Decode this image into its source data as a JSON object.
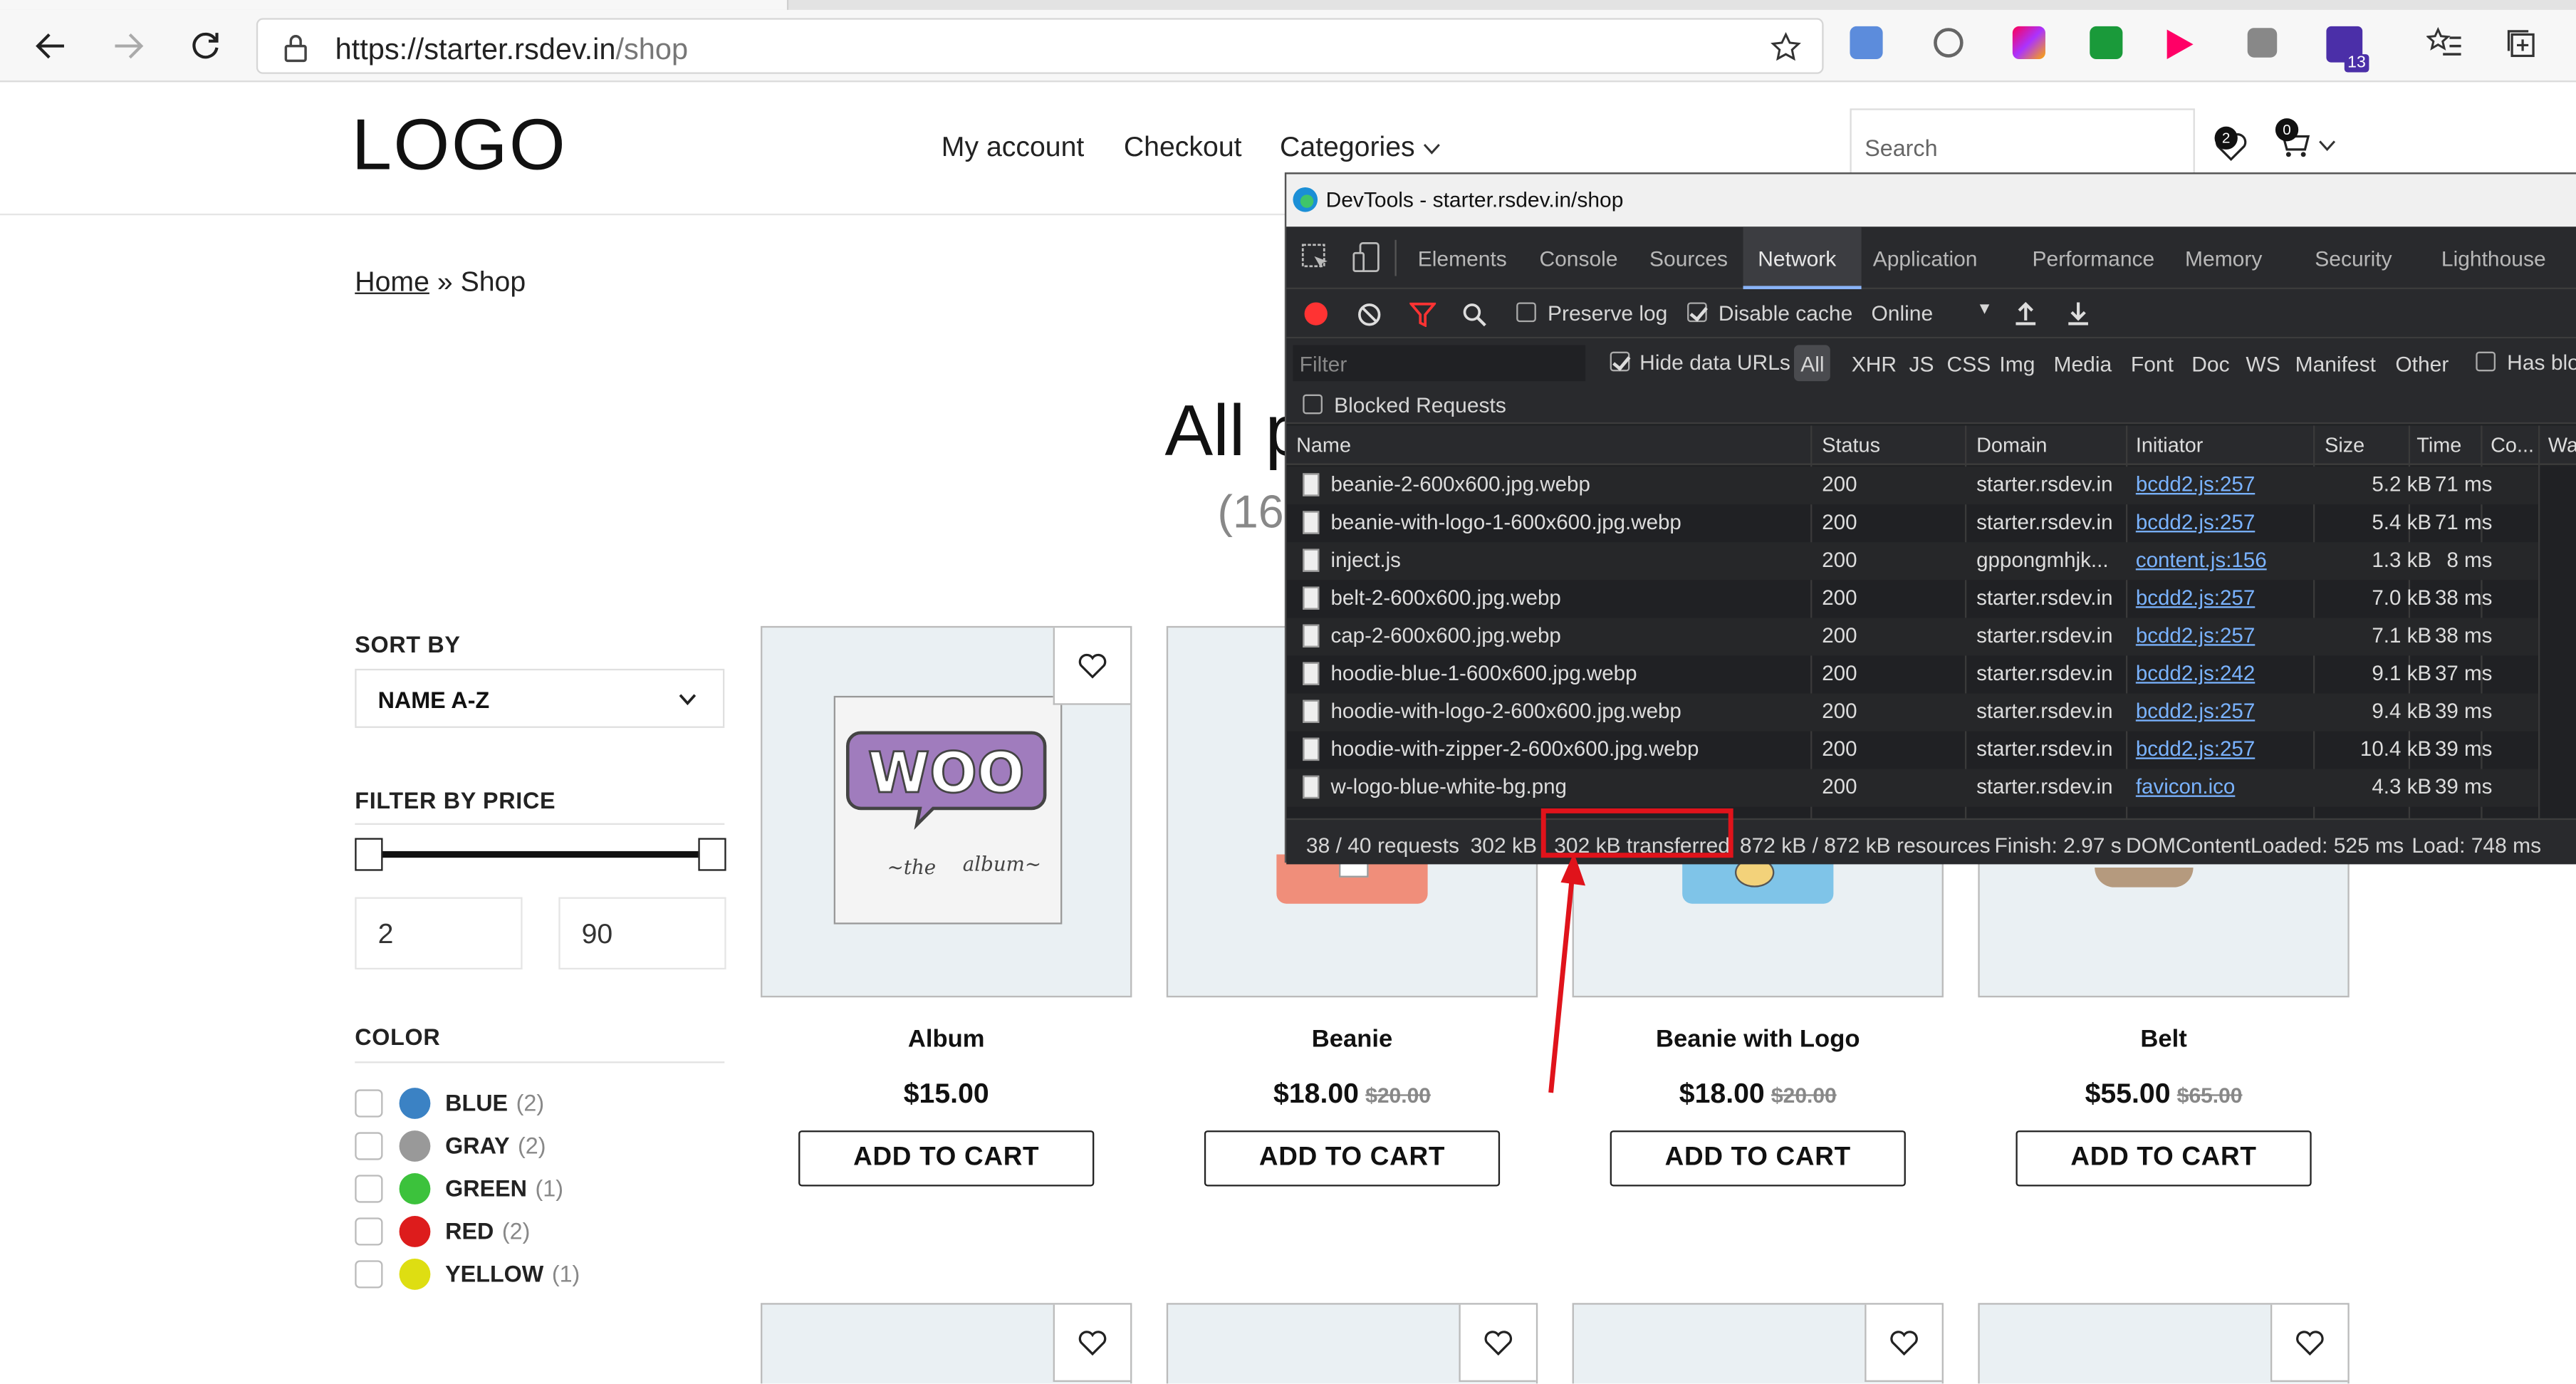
{
  "browser": {
    "url_main": "https://starter.rsdev.in",
    "url_path": "/shop"
  },
  "site": {
    "logo": "LOGO",
    "menu": [
      "My account",
      "Checkout",
      "Categories"
    ],
    "search_placeholder": "Search",
    "wishlist_count": "2",
    "cart_count": "0"
  },
  "breadcrumb": {
    "home": "Home",
    "sep": "»",
    "current": "Shop"
  },
  "shop": {
    "title": "All p",
    "count": "(16"
  },
  "sidebar": {
    "sort_label": "SORT BY",
    "sort_value": "NAME A-Z",
    "price_label": "FILTER BY PRICE",
    "price_min": "2",
    "price_max": "90",
    "color_label": "COLOR",
    "colors": [
      {
        "name": "BLUE",
        "count": "(2)",
        "hex": "#3b82c4"
      },
      {
        "name": "GRAY",
        "count": "(2)",
        "hex": "#999999"
      },
      {
        "name": "GREEN",
        "count": "(1)",
        "hex": "#3cc23c"
      },
      {
        "name": "RED",
        "count": "(2)",
        "hex": "#dd1c1c"
      },
      {
        "name": "YELLOW",
        "count": "(1)",
        "hex": "#dede12"
      }
    ]
  },
  "products": [
    {
      "name": "Album",
      "price": "$15.00",
      "old_price": "",
      "button": "ADD TO CART",
      "woo_text": "WOO",
      "album_left": "~the",
      "album_right": "album~"
    },
    {
      "name": "Beanie",
      "price": "$18.00",
      "old_price": "$20.00",
      "button": "ADD TO CART"
    },
    {
      "name": "Beanie with Logo",
      "price": "$18.00",
      "old_price": "$20.00",
      "button": "ADD TO CART"
    },
    {
      "name": "Belt",
      "price": "$55.00",
      "old_price": "$65.00",
      "button": "ADD TO CART"
    }
  ],
  "devtools": {
    "title": "DevTools - starter.rsdev.in/shop",
    "tabs": [
      "Elements",
      "Console",
      "Sources",
      "Network",
      "Application",
      "Performance",
      "Memory",
      "Security",
      "Lighthouse"
    ],
    "active_tab": "Network",
    "preserve_log": "Preserve log",
    "disable_cache": "Disable cache",
    "throttle": "Online",
    "filter_placeholder": "Filter",
    "hide_data_urls": "Hide data URLs",
    "type_filters": [
      "All",
      "XHR",
      "JS",
      "CSS",
      "Img",
      "Media",
      "Font",
      "Doc",
      "WS",
      "Manifest",
      "Other"
    ],
    "has_blocked": "Has blo",
    "blocked_requests": "Blocked Requests",
    "columns": [
      "Name",
      "Status",
      "Domain",
      "Initiator",
      "Size",
      "Time",
      "Co...",
      "Wa"
    ],
    "rows": [
      {
        "name": "beanie-2-600x600.jpg.webp",
        "status": "200",
        "domain": "starter.rsdev.in",
        "initiator": "bcdd2.js:257",
        "size": "5.2 kB",
        "time": "71 ms"
      },
      {
        "name": "beanie-with-logo-1-600x600.jpg.webp",
        "status": "200",
        "domain": "starter.rsdev.in",
        "initiator": "bcdd2.js:257",
        "size": "5.4 kB",
        "time": "71 ms"
      },
      {
        "name": "inject.js",
        "status": "200",
        "domain": "gppongmhjk...",
        "initiator": "content.js:156",
        "size": "1.3 kB",
        "time": "8 ms"
      },
      {
        "name": "belt-2-600x600.jpg.webp",
        "status": "200",
        "domain": "starter.rsdev.in",
        "initiator": "bcdd2.js:257",
        "size": "7.0 kB",
        "time": "38 ms"
      },
      {
        "name": "cap-2-600x600.jpg.webp",
        "status": "200",
        "domain": "starter.rsdev.in",
        "initiator": "bcdd2.js:257",
        "size": "7.1 kB",
        "time": "38 ms"
      },
      {
        "name": "hoodie-blue-1-600x600.jpg.webp",
        "status": "200",
        "domain": "starter.rsdev.in",
        "initiator": "bcdd2.js:242",
        "size": "9.1 kB",
        "time": "37 ms"
      },
      {
        "name": "hoodie-with-logo-2-600x600.jpg.webp",
        "status": "200",
        "domain": "starter.rsdev.in",
        "initiator": "bcdd2.js:257",
        "size": "9.4 kB",
        "time": "39 ms"
      },
      {
        "name": "hoodie-with-zipper-2-600x600.jpg.webp",
        "status": "200",
        "domain": "starter.rsdev.in",
        "initiator": "bcdd2.js:257",
        "size": "10.4 kB",
        "time": "39 ms"
      },
      {
        "name": "w-logo-blue-white-bg.png",
        "status": "200",
        "domain": "starter.rsdev.in",
        "initiator": "favicon.ico",
        "size": "4.3 kB",
        "time": "39 ms"
      }
    ],
    "summary": {
      "requests": "38 / 40 requests",
      "size": "302 kB",
      "transferred": "302 kB transferred",
      "resources": "872 kB / 872 kB resources",
      "finish": "Finish: 2.97 s",
      "dcl": "DOMContentLoaded: 525 ms",
      "load": "Load: 748 ms"
    }
  },
  "annotation": {
    "highlight_color": "#e0131b"
  }
}
